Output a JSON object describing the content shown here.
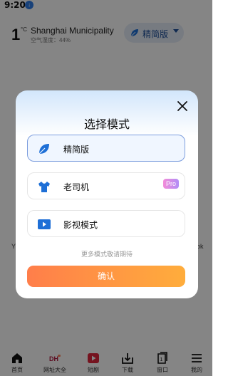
{
  "status_bar": {
    "time": "9:20",
    "download_indicator": "download-arrow"
  },
  "weather": {
    "temperature": "1",
    "unit": "°C",
    "city": "Shanghai Municipality",
    "humidity": "空气湿度：44%"
  },
  "mode_pill": {
    "label": "精简版"
  },
  "background_fragments": {
    "left_edge": "Y",
    "right_edge": "ok"
  },
  "dialog": {
    "title": "选择模式",
    "options": [
      {
        "label": "精简版",
        "icon": "leaf-icon",
        "selected": true
      },
      {
        "label": "老司机",
        "icon": "shirt-icon",
        "badge": "Pro"
      },
      {
        "label": "影视模式",
        "icon": "video-play-icon"
      }
    ],
    "more_tip": "更多模式敬请期待",
    "confirm_label": "确认"
  },
  "bottom_nav": [
    {
      "label": "首页",
      "icon": "home-icon"
    },
    {
      "label": "网址大全",
      "icon": "dh-logo-icon",
      "logo_text": "DH"
    },
    {
      "label": "短剧",
      "icon": "short-drama-play-icon"
    },
    {
      "label": "下载",
      "icon": "download-icon"
    },
    {
      "label": "窗口",
      "icon": "window-icon",
      "count": "1"
    },
    {
      "label": "我的",
      "icon": "menu-icon"
    }
  ],
  "colors": {
    "accent_blue": "#1d4f9a",
    "leaf_blue": "#1e6fd6",
    "confirm_start": "#ff7e4a",
    "confirm_end": "#ffad3c",
    "pro_badge": "#d88df0"
  }
}
